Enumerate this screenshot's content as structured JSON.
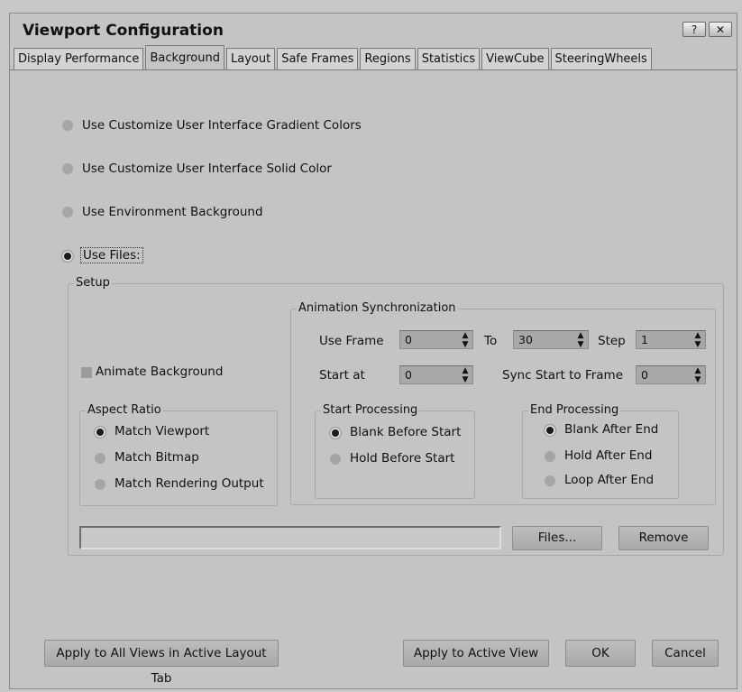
{
  "window": {
    "title": "Viewport Configuration",
    "help_label": "?",
    "close_label": "✕"
  },
  "tabs": [
    {
      "label": "Display Performance",
      "active": false
    },
    {
      "label": "Background",
      "active": true
    },
    {
      "label": "Layout",
      "active": false
    },
    {
      "label": "Safe Frames",
      "active": false
    },
    {
      "label": "Regions",
      "active": false
    },
    {
      "label": "Statistics",
      "active": false
    },
    {
      "label": "ViewCube",
      "active": false
    },
    {
      "label": "SteeringWheels",
      "active": false
    }
  ],
  "bg_options": [
    {
      "label": "Use Customize User Interface Gradient Colors",
      "selected": false
    },
    {
      "label": "Use Customize User Interface Solid Color",
      "selected": false
    },
    {
      "label": "Use Environment Background",
      "selected": false
    },
    {
      "label": "Use Files:",
      "selected": true
    }
  ],
  "setup": {
    "title": "Setup",
    "animate_background": {
      "label": "Animate Background",
      "checked": false
    },
    "aspect_ratio": {
      "title": "Aspect Ratio",
      "options": [
        {
          "label": "Match Viewport",
          "selected": true
        },
        {
          "label": "Match Bitmap",
          "selected": false
        },
        {
          "label": "Match Rendering Output",
          "selected": false
        }
      ]
    },
    "anim_sync": {
      "title": "Animation Synchronization",
      "use_frame_label": "Use Frame",
      "use_frame_value": "0",
      "to_label": "To",
      "to_value": "30",
      "step_label": "Step",
      "step_value": "1",
      "start_at_label": "Start at",
      "start_at_value": "0",
      "sync_start_label": "Sync Start to Frame",
      "sync_start_value": "0",
      "start_processing": {
        "title": "Start Processing",
        "options": [
          {
            "label": "Blank Before Start",
            "selected": true
          },
          {
            "label": "Hold Before Start",
            "selected": false
          }
        ]
      },
      "end_processing": {
        "title": "End Processing",
        "options": [
          {
            "label": "Blank After End",
            "selected": true
          },
          {
            "label": "Hold After End",
            "selected": false
          },
          {
            "label": "Loop After End",
            "selected": false
          }
        ]
      }
    },
    "file_path": "",
    "files_button": "Files...",
    "remove_button": "Remove"
  },
  "footer": {
    "apply_all": "Apply to All Views in Active Layout Tab",
    "apply_active": "Apply to Active View",
    "ok": "OK",
    "cancel": "Cancel"
  },
  "spinner_arrows": "▲▼"
}
